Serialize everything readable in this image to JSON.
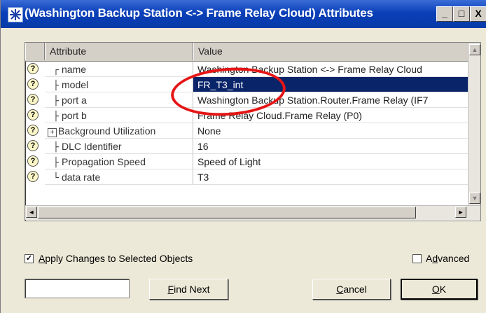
{
  "window": {
    "title": "(Washington Backup Station <-> Frame Relay Cloud) Attributes",
    "controls": {
      "minimize": "_",
      "maximize": "□",
      "close": "X"
    }
  },
  "table": {
    "columns": [
      "Attribute",
      "Value"
    ],
    "rows": [
      {
        "tree": "┌",
        "name": "name",
        "value": "Washington Backup Station <-> Frame Relay Cloud",
        "selected": false
      },
      {
        "tree": "├",
        "name": "model",
        "value": "FR_T3_int",
        "selected": true
      },
      {
        "tree": "├",
        "name": "port a",
        "value": "Washington Backup Station.Router.Frame Relay (IF7",
        "selected": false
      },
      {
        "tree": "├",
        "name": "port b",
        "value": "Frame Relay Cloud.Frame Relay (P0)",
        "selected": false
      },
      {
        "tree": "+",
        "name": "Background Utilization",
        "value": "None",
        "selected": false
      },
      {
        "tree": "├",
        "name": "DLC Identifier",
        "value": "16",
        "selected": false
      },
      {
        "tree": "├",
        "name": "Propagation Speed",
        "value": "Speed of Light",
        "selected": false
      },
      {
        "tree": "└",
        "name": "data rate",
        "value": "T3",
        "selected": false
      }
    ],
    "help_glyph": "?",
    "highlight_color": "#e61515",
    "selection_color": "#0a246a"
  },
  "options": {
    "apply_changes": {
      "label_u": "A",
      "label_rest": "pply Changes to Selected Objects",
      "checked": true
    },
    "advanced": {
      "label_pre": "A",
      "label_u": "d",
      "label_rest": "vanced",
      "checked": false
    }
  },
  "buttons": {
    "find_next": {
      "u": "F",
      "rest": "ind Next"
    },
    "cancel": {
      "u": "C",
      "rest": "ancel"
    },
    "ok": {
      "u": "O",
      "rest": "K"
    }
  },
  "find_input": {
    "value": ""
  }
}
